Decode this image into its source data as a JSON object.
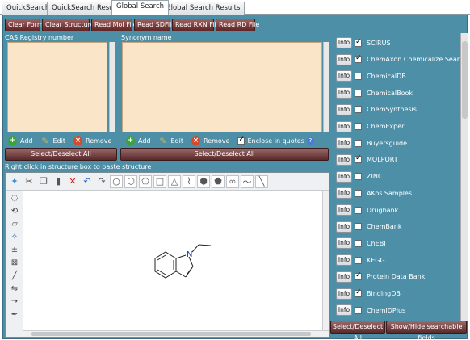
{
  "tabs": [
    "QuickSearch",
    "QuickSearch Results",
    "Global Search",
    "Global Search Results"
  ],
  "active_tab": "Global Search",
  "toolbar": {
    "clear_form": "Clear Form",
    "clear_structure": "Clear Structure",
    "read_mol": "Read Mol File",
    "read_sd": "Read SDFile",
    "read_rxn": "Read RXN File",
    "read_rd": "Read RD File"
  },
  "cas_panel": {
    "label": "CAS Registry number",
    "add": "Add",
    "edit": "Edit",
    "remove": "Remove",
    "select_all": "Select/Deselect All"
  },
  "synonym_panel": {
    "label": "Synonym name",
    "add": "Add",
    "edit": "Edit",
    "remove": "Remove",
    "enclose": "Enclose in quotes",
    "enclose_checked": true,
    "select_all": "Select/Deselect All"
  },
  "structure": {
    "hint": "Right click in structure box to paste structure"
  },
  "databases": {
    "info_label": "Info",
    "items": [
      {
        "name": "SCIRUS",
        "checked": true
      },
      {
        "name": "ChemAxon Chemicalize Search",
        "checked": true
      },
      {
        "name": "ChemicalDB",
        "checked": false
      },
      {
        "name": "ChemicalBook",
        "checked": false
      },
      {
        "name": "ChemSynthesis",
        "checked": false
      },
      {
        "name": "ChemExper",
        "checked": false
      },
      {
        "name": "Buyersguide",
        "checked": false
      },
      {
        "name": "MOLPORT",
        "checked": true
      },
      {
        "name": "ZINC",
        "checked": false
      },
      {
        "name": "AKos Samples",
        "checked": false
      },
      {
        "name": "Drugbank",
        "checked": false
      },
      {
        "name": "ChemBank",
        "checked": false
      },
      {
        "name": "ChEBI",
        "checked": false
      },
      {
        "name": "KEGG",
        "checked": false
      },
      {
        "name": "Protein Data Bank",
        "checked": true
      },
      {
        "name": "BindingDB",
        "checked": true
      },
      {
        "name": "ChemIDPlus",
        "checked": false
      }
    ],
    "select_all": "Select/Deselect All",
    "show_hide": "Show/Hide searchable fields"
  },
  "colors": {
    "panel": "#4e8fa8",
    "textbox": "#fbe5c8",
    "button": "#6e3030"
  }
}
